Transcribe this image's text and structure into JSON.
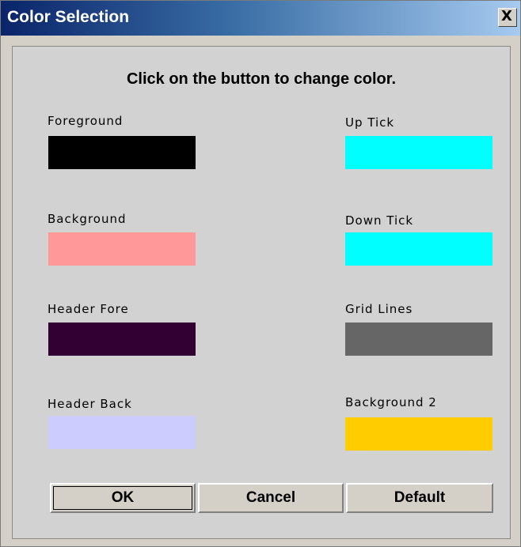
{
  "window": {
    "title": "Color Selection",
    "close_glyph": "X"
  },
  "instruction": "Click on the button to change color.",
  "swatches": [
    {
      "label": "Foreground",
      "color": "#000000"
    },
    {
      "label": "Up Tick",
      "color": "#00ffff"
    },
    {
      "label": "Background",
      "color": "#ff9999"
    },
    {
      "label": "Down Tick",
      "color": "#00ffff"
    },
    {
      "label": "Header Fore",
      "color": "#330033"
    },
    {
      "label": "Grid Lines",
      "color": "#666666"
    },
    {
      "label": "Header Back",
      "color": "#ccccff"
    },
    {
      "label": "Background 2",
      "color": "#ffcc00"
    }
  ],
  "buttons": {
    "ok": "OK",
    "cancel": "Cancel",
    "default": "Default"
  }
}
